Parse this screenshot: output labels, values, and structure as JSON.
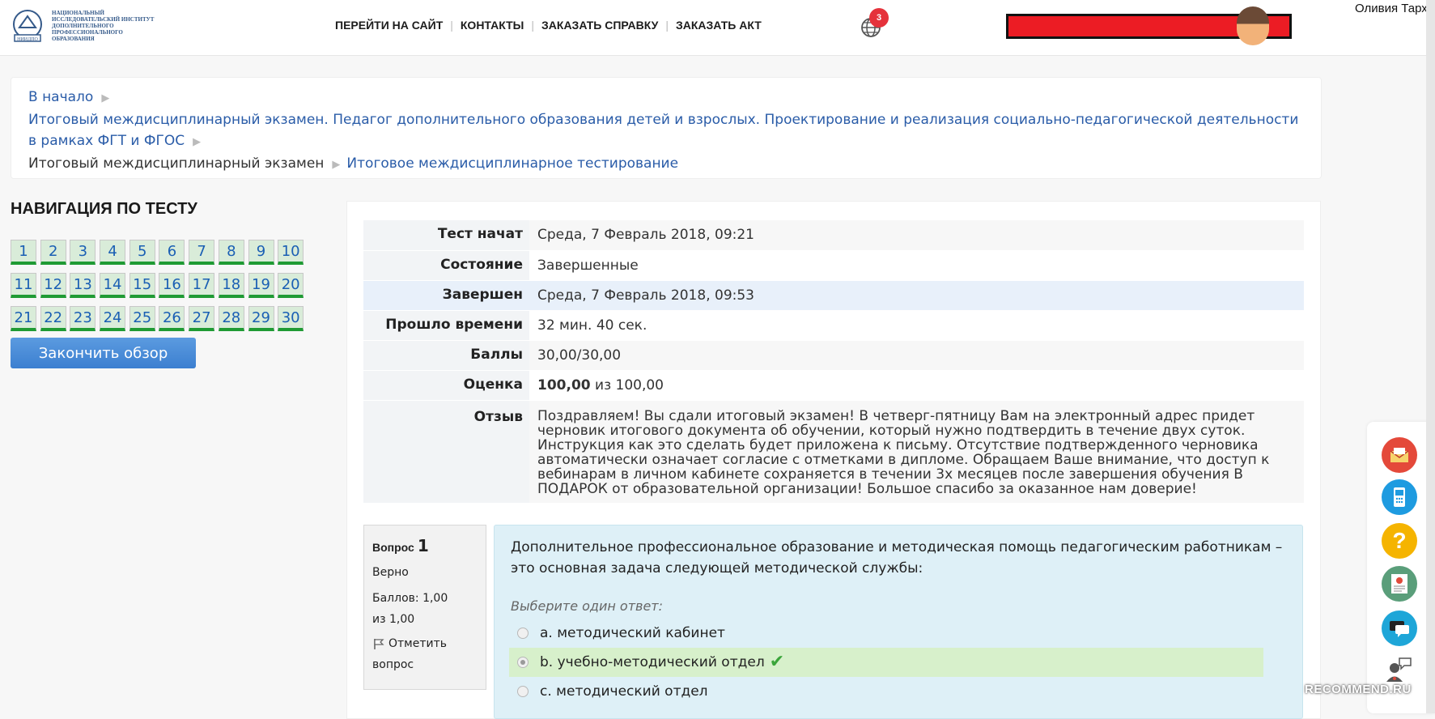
{
  "header": {
    "logo_text": "Национальный исследовательский институт дополнительного профессионального образования",
    "logo_mark": "НИИДПО",
    "nav": [
      "ПЕРЕЙТИ НА САЙТ",
      "КОНТАКТЫ",
      "ЗАКАЗАТЬ СПРАВКУ",
      "ЗАКАЗАТЬ АКТ"
    ],
    "notification_count": "3",
    "user_name": "Оливия Тарх"
  },
  "breadcrumb": {
    "home": "В начало",
    "course": "Итоговый междисциплинарный экзамен. Педагог дополнительного образования детей и взрослых. Проектирование и реализация социально-педагогической деятельности в рамках ФГТ и ФГОС",
    "section": "Итоговый междисциплинарный экзамен",
    "current": "Итоговое междисциплинарное тестирование"
  },
  "quiz_nav": {
    "title": "НАВИГАЦИЯ ПО ТЕСТУ",
    "questions": [
      "1",
      "2",
      "3",
      "4",
      "5",
      "6",
      "7",
      "8",
      "9",
      "10",
      "11",
      "12",
      "13",
      "14",
      "15",
      "16",
      "17",
      "18",
      "19",
      "20",
      "21",
      "22",
      "23",
      "24",
      "25",
      "26",
      "27",
      "28",
      "29",
      "30"
    ],
    "finish_label": "Закончить обзор"
  },
  "summary": {
    "started_label": "Тест начат",
    "started_value": "Среда, 7 Февраль 2018, 09:21",
    "state_label": "Состояние",
    "state_value": "Завершенные",
    "completed_label": "Завершен",
    "completed_value": "Среда, 7 Февраль 2018, 09:53",
    "time_label": "Прошло времени",
    "time_value": "32 мин. 40 сек.",
    "marks_label": "Баллы",
    "marks_value": "30,00/30,00",
    "grade_label": "Оценка",
    "grade_value": "100,00",
    "grade_suffix": "из 100,00",
    "feedback_label": "Отзыв",
    "feedback_value": "Поздравляем! Вы сдали итоговый экзамен! В четверг-пятницу Вам на электронный адрес придет черновик итогового документа об обучении, который нужно подтвердить в течение двух суток. Инструкция как это сделать будет приложена к письму. Отсутствие подтвержденного черновика автоматически означает согласие с отметками в дипломе. Обращаем Ваше внимание, что доступ к вебинарам в личном кабинете сохраняется в течении 3х месяцев после завершения обучения В ПОДАРОК от образовательной организации! Большое спасибо за оказанное нам доверие!"
  },
  "question": {
    "label": "Вопрос",
    "number": "1",
    "status": "Верно",
    "points": "Баллов: 1,00 из 1,00",
    "flag_label": "Отметить вопрос",
    "text": "Дополнительное профессиональное образование и методическая помощь педагогическим работникам – это основная задача следующей методической службы:",
    "prompt": "Выберите один ответ:",
    "answers": [
      {
        "text": "a. методический кабинет",
        "selected": false
      },
      {
        "text": "b. учебно-методический отдел",
        "selected": true
      },
      {
        "text": "c. методический отдел",
        "selected": false
      }
    ]
  },
  "widgets": [
    "mail-icon",
    "phone-icon",
    "help-icon",
    "certificate-icon",
    "chat-icon",
    "support-agent-icon"
  ],
  "watermark": "RECOMMEND.RU",
  "colors": {
    "link": "#2a5ca8",
    "nav_correct": "#1f9b34",
    "button": "#4a8ad8",
    "question_bg": "#def0f7",
    "correct_bg": "#d7f0cb"
  }
}
